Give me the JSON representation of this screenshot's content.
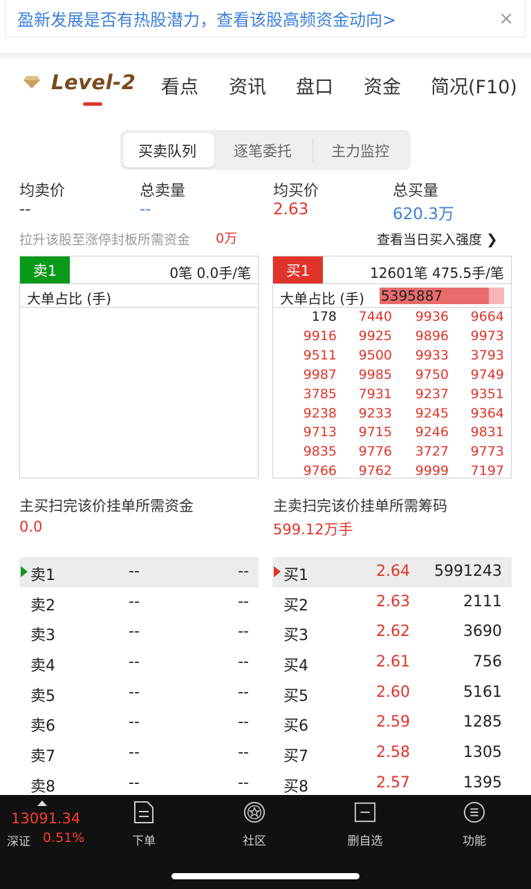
{
  "banner": {
    "text": "盈新发展是否有热股潜力，查看该股高频资金动向>",
    "close": "×"
  },
  "nav": {
    "brand": "Level-2",
    "tabs": [
      "看点",
      "资讯",
      "盘口",
      "资金",
      "简况(F10)"
    ]
  },
  "segments": [
    "买卖队列",
    "逐笔委托",
    "主力监控"
  ],
  "summary": {
    "avg_sell_label": "均卖价",
    "avg_sell": "--",
    "total_sell_label": "总卖量",
    "total_sell": "--",
    "avg_buy_label": "均买价",
    "avg_buy": "2.63",
    "total_buy_label": "总买量",
    "total_buy": "620.3万",
    "tip": "拉升该股至涨停封板所需资金",
    "tip_value": "0万",
    "link": "查看当日买入强度"
  },
  "sell_queue": {
    "tag": "卖1",
    "info": "0笔   0.0手/笔",
    "big_label": "大单占比 (手)"
  },
  "buy_queue": {
    "tag": "买1",
    "info": "12601笔   475.5手/笔",
    "big_label": "大单占比 (手)",
    "big_value": "5395887",
    "big_ratio": 0.88,
    "orders": [
      "178",
      "7440",
      "9936",
      "9664",
      "9916",
      "9925",
      "9896",
      "9973",
      "9511",
      "9500",
      "9933",
      "3793",
      "9987",
      "9985",
      "9750",
      "9749",
      "3785",
      "7931",
      "9237",
      "9351",
      "9238",
      "9233",
      "9245",
      "9364",
      "9713",
      "9715",
      "9246",
      "9831",
      "9835",
      "9776",
      "3727",
      "9773",
      "9766",
      "9762",
      "9999",
      "7197"
    ]
  },
  "sweep": {
    "buy_label": "主买扫完该价挂单所需资金",
    "buy_value": "0.0",
    "sell_label": "主卖扫完该价挂单所需筹码",
    "sell_value": "599.12万手"
  },
  "sell_levels": [
    {
      "name": "卖1",
      "price": "--",
      "vol": "--"
    },
    {
      "name": "卖2",
      "price": "--",
      "vol": "--"
    },
    {
      "name": "卖3",
      "price": "--",
      "vol": "--"
    },
    {
      "name": "卖4",
      "price": "--",
      "vol": "--"
    },
    {
      "name": "卖5",
      "price": "--",
      "vol": "--"
    },
    {
      "name": "卖6",
      "price": "--",
      "vol": "--"
    },
    {
      "name": "卖7",
      "price": "--",
      "vol": "--"
    },
    {
      "name": "卖8",
      "price": "--",
      "vol": "--"
    }
  ],
  "buy_levels": [
    {
      "name": "买1",
      "price": "2.64",
      "vol": "5991243"
    },
    {
      "name": "买2",
      "price": "2.63",
      "vol": "2111"
    },
    {
      "name": "买3",
      "price": "2.62",
      "vol": "3690"
    },
    {
      "name": "买4",
      "price": "2.61",
      "vol": "756"
    },
    {
      "name": "买5",
      "price": "2.60",
      "vol": "5161"
    },
    {
      "name": "买6",
      "price": "2.59",
      "vol": "1285"
    },
    {
      "name": "买7",
      "price": "2.58",
      "vol": "1305"
    },
    {
      "name": "买8",
      "price": "2.57",
      "vol": "1395"
    }
  ],
  "bottom": {
    "index_value": "13091.34",
    "index_name": "深证",
    "index_pct": "0.51%",
    "items": [
      "下单",
      "社区",
      "删自选",
      "功能"
    ]
  },
  "colors": {
    "sell_green": "#0a9a1a",
    "buy_red": "#e0342a",
    "accent_blue": "#3c7fd9"
  }
}
